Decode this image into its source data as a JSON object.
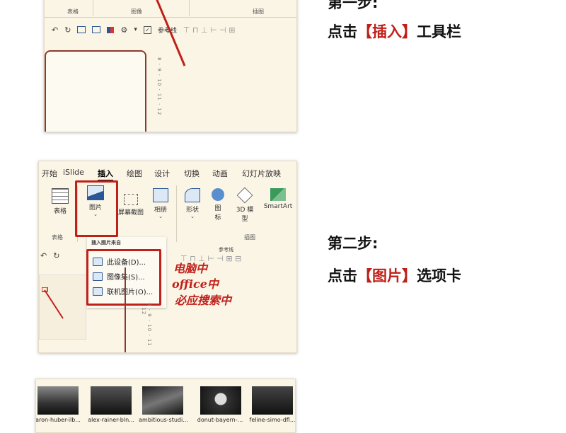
{
  "step1": {
    "heading_partial": "第一步:",
    "instruction_prefix": "点击",
    "instruction_highlight": "【插入】",
    "instruction_suffix": "工具栏",
    "ribbon_groups": [
      "表格",
      "图像",
      "插图"
    ],
    "reference_line_label": "参考线",
    "ruler_text": "8 · 9 · 10 · 11 · 12"
  },
  "step2": {
    "heading": "第二步:",
    "instruction_prefix": "点击",
    "instruction_highlight": "【图片】",
    "instruction_suffix": "选项卡",
    "tabs": [
      "开始",
      "iSlide",
      "插入",
      "绘图",
      "设计",
      "切换",
      "动画",
      "幻灯片放映"
    ],
    "active_tab": "插入",
    "ribbon_buttons": {
      "table": "表格",
      "picture": "图片",
      "screenshot": "屏幕截图",
      "album": "相册",
      "shapes": "形状",
      "icons_line1": "图",
      "icons_line2": "标",
      "model_3d_line1": "3D 模",
      "model_3d_line2": "型",
      "smartart": "SmartArt"
    },
    "groups": {
      "table": "表格",
      "illustrations": "插图"
    },
    "reference_line_label": "参考线",
    "dropdown": {
      "title": "插入图片来自",
      "items": [
        "此设备(D)...",
        "图像集(S)...",
        "联机图片(O)..."
      ]
    },
    "annotation": {
      "line1": "电脑中",
      "line2": "office中",
      "line3": "必应搜索中"
    },
    "ruler_text": "8 · 9 · 10 · 11 · 12"
  },
  "step3": {
    "thumbnails": [
      "aron-huber-ilb...",
      "alex-rainer-bln...",
      "ambitious-studi...",
      "donut-bayern-...",
      "feline-simo-dfl..."
    ]
  },
  "colors": {
    "accent_red": "#c0201a",
    "panel_bg": "#fbf5e6",
    "text": "#111111"
  }
}
